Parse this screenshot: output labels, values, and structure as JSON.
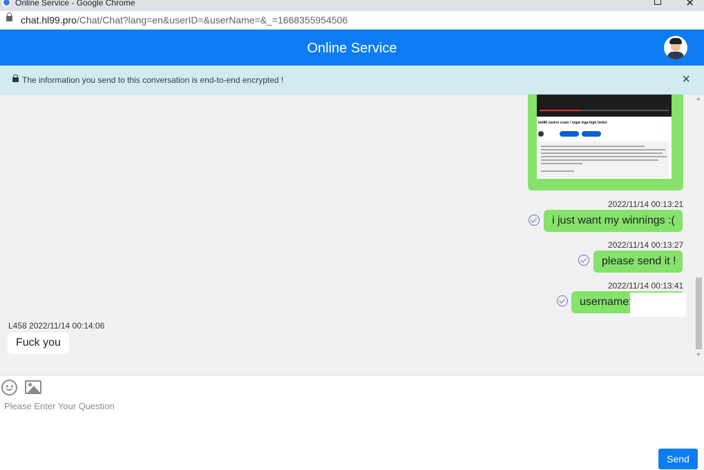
{
  "browser": {
    "window_title": "Online Service - Google Chrome",
    "url_domain": "chat.hl99.pro",
    "url_path": "/Chat/Chat?lang=en&userID=&userName=&_=1668355954506"
  },
  "header": {
    "title": "Online Service",
    "avatar_icon": "agent-avatar"
  },
  "notice": {
    "text": "The information you send to this conversation is end-to-end encrypted !",
    "close_label": "×",
    "background": "#d1ecf1"
  },
  "image_message": {
    "video_title": "bet86 casino scam ! ingat mga high bettor"
  },
  "messages": [
    {
      "timestamp": "2022/11/14 00:13:21",
      "text": "i just want my winnings :(",
      "status_icon": "read-check-icon"
    },
    {
      "timestamp": "2022/11/14 00:13:27",
      "text": "please send it !",
      "status_icon": "read-check-icon"
    },
    {
      "timestamp": "2022/11/14 00:13:41",
      "text": "username:",
      "status_icon": "read-check-icon"
    }
  ],
  "agent_message": {
    "meta": "L458 2022/11/14 00:14:06",
    "text": "Fuck you"
  },
  "composer": {
    "placeholder": "Please Enter Your Question",
    "send_label": "Send",
    "emoji_icon": "emoji-icon",
    "image_icon": "image-icon"
  },
  "colors": {
    "brand": "#0d7cf2",
    "outgoing_bubble": "#85e26a",
    "incoming_bubble": "#ffffff",
    "chat_background": "#f1f1f1",
    "read_check": "#6b73c9"
  }
}
